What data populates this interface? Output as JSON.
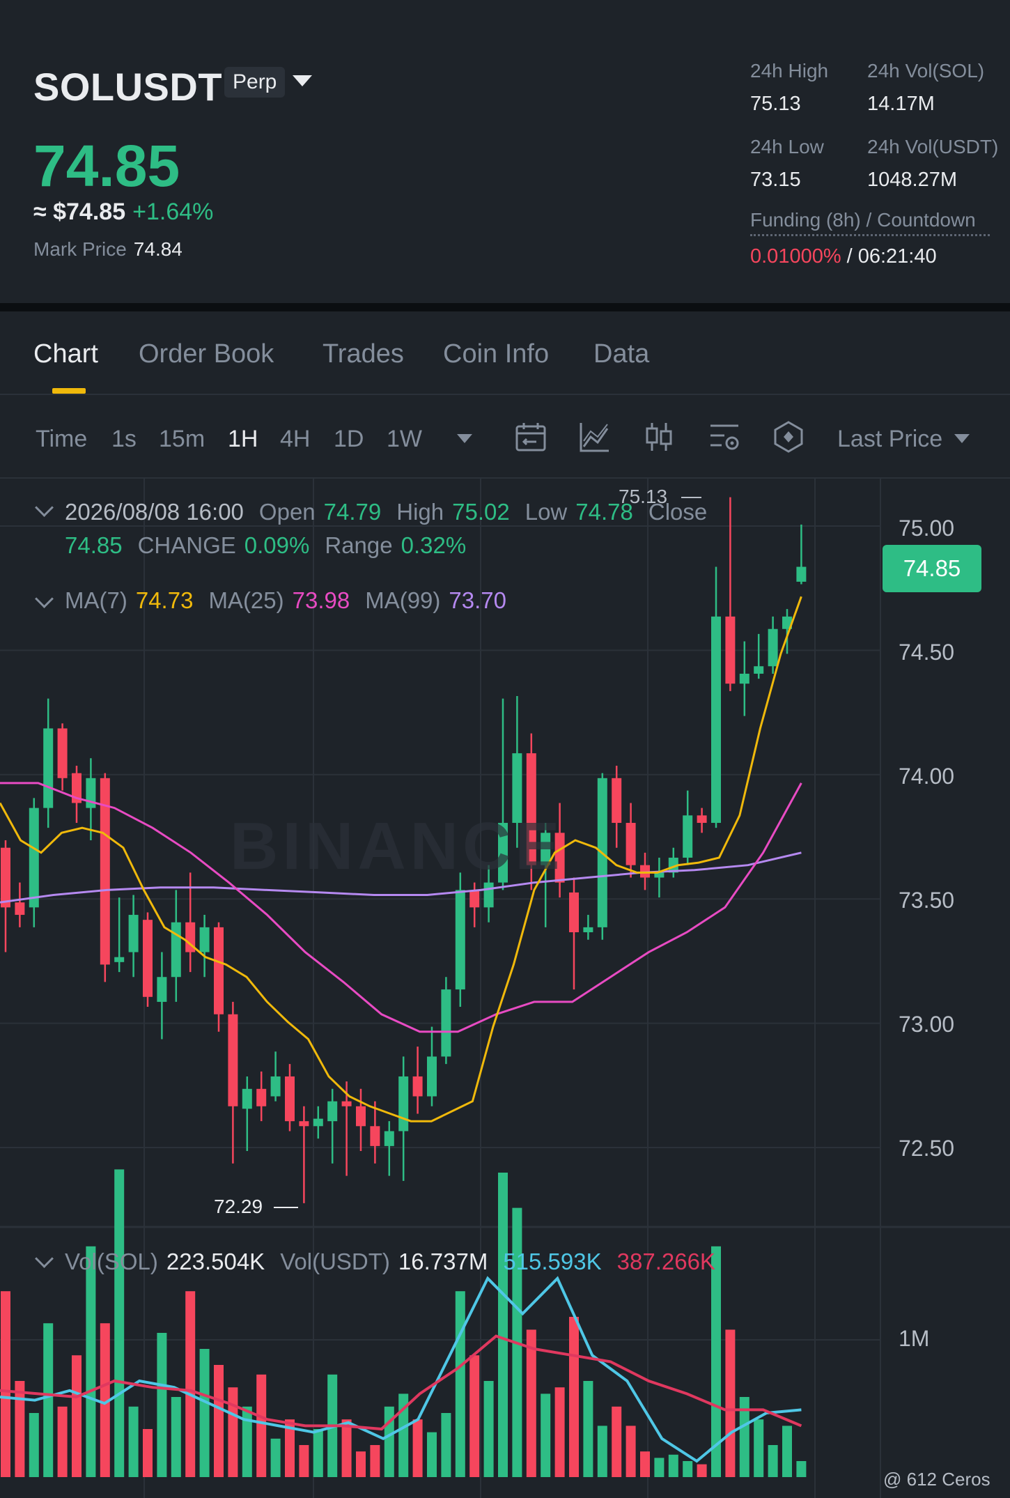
{
  "header": {
    "symbol": "SOLUSDT",
    "badge": "Perp",
    "last_price": "74.85",
    "usd_price": "≈ $74.85",
    "change_pct": "+1.64%",
    "mark_price_label": "Mark Price",
    "mark_price": "74.84",
    "stats": [
      {
        "label": "24h High",
        "value": "75.13"
      },
      {
        "label": "24h Vol(SOL)",
        "value": "14.17M"
      },
      {
        "label": "24h Low",
        "value": "73.15"
      },
      {
        "label": "24h Vol(USDT)",
        "value": "1048.27M"
      }
    ],
    "funding_label": "Funding (8h) / Countdown",
    "funding_rate": "0.01000%",
    "funding_sep": "/",
    "countdown": "06:21:40"
  },
  "tabs": [
    {
      "label": "Chart",
      "active": true
    },
    {
      "label": "Order Book"
    },
    {
      "label": "Trades"
    },
    {
      "label": "Coin Info"
    },
    {
      "label": "Data"
    }
  ],
  "toolbar": {
    "time_label": "Time",
    "intervals": [
      "1s",
      "15m",
      "1H",
      "4H",
      "1D",
      "1W"
    ],
    "active_interval": "1H",
    "price_type": "Last Price",
    "icons": [
      "calendar-icon",
      "indicator-icon",
      "candle-type-icon",
      "settings-icon",
      "drawing-icon"
    ]
  },
  "legend": {
    "date": "2026/08/08 16:00",
    "open_label": "Open",
    "open": "74.79",
    "high_label": "High",
    "high": "75.02",
    "low_label": "Low",
    "low": "74.78",
    "close_label": "Close",
    "close": "74.85",
    "change_label": "CHANGE",
    "change": "0.09%",
    "range_label": "Range",
    "range": "0.32%",
    "ma7_label": "MA(7)",
    "ma7": "74.73",
    "ma25_label": "MA(25)",
    "ma25": "73.98",
    "ma99_label": "MA(99)",
    "ma99": "73.70"
  },
  "volume_legend": {
    "sol_label": "Vol(SOL)",
    "sol": "223.504K",
    "usdt_label": "Vol(USDT)",
    "usdt": "16.737M",
    "ma_a": "515.593K",
    "ma_b": "387.266K"
  },
  "current_price_tag": "74.85",
  "high_marker": "75.13",
  "low_marker": "72.29",
  "watermark": "BINANCE",
  "footer": "@ 612 Ceros",
  "colors": {
    "up": "#2ebd85",
    "down": "#f6465d",
    "ma7": "#f0b90b",
    "ma25": "#e84bc3",
    "ma99": "#b589f0",
    "vol_ma_a": "#4fc7e6",
    "vol_ma_b": "#e0385f"
  },
  "chart_data": {
    "type": "candlestick",
    "y_ticks": [
      "75.00",
      "74.50",
      "74.00",
      "73.50",
      "73.00",
      "72.50"
    ],
    "ylim": [
      72.2,
      75.15
    ],
    "candles": [
      [
        73.72,
        73.48,
        73.75,
        73.3
      ],
      [
        73.5,
        73.45,
        73.58,
        73.4
      ],
      [
        73.48,
        73.88,
        73.92,
        73.4
      ],
      [
        73.88,
        74.2,
        74.32,
        73.8
      ],
      [
        74.2,
        74.0,
        74.22,
        73.95
      ],
      [
        74.02,
        73.9,
        74.05,
        73.82
      ],
      [
        73.88,
        74.0,
        74.08,
        73.75
      ],
      [
        74.0,
        73.25,
        74.02,
        73.18
      ],
      [
        73.26,
        73.28,
        73.52,
        73.22
      ],
      [
        73.3,
        73.45,
        73.53,
        73.2
      ],
      [
        73.43,
        73.12,
        73.46,
        73.08
      ],
      [
        73.1,
        73.2,
        73.3,
        72.95
      ],
      [
        73.2,
        73.42,
        73.55,
        73.1
      ],
      [
        73.42,
        73.3,
        73.62,
        73.22
      ],
      [
        73.3,
        73.4,
        73.45,
        73.2
      ],
      [
        73.4,
        73.05,
        73.42,
        72.98
      ],
      [
        73.05,
        72.68,
        73.1,
        72.45
      ],
      [
        72.67,
        72.75,
        72.8,
        72.5
      ],
      [
        72.75,
        72.68,
        72.82,
        72.62
      ],
      [
        72.72,
        72.8,
        72.9,
        72.7
      ],
      [
        72.8,
        72.62,
        72.85,
        72.58
      ],
      [
        72.62,
        72.6,
        72.68,
        72.29
      ],
      [
        72.6,
        72.63,
        72.68,
        72.55
      ],
      [
        72.62,
        72.7,
        72.75,
        72.45
      ],
      [
        72.7,
        72.68,
        72.78,
        72.4
      ],
      [
        72.68,
        72.6,
        72.75,
        72.5
      ],
      [
        72.6,
        72.52,
        72.7,
        72.45
      ],
      [
        72.52,
        72.58,
        72.62,
        72.4
      ],
      [
        72.58,
        72.8,
        72.88,
        72.38
      ],
      [
        72.8,
        72.72,
        72.92,
        72.65
      ],
      [
        72.72,
        72.88,
        73.0,
        72.68
      ],
      [
        72.88,
        73.15,
        73.2,
        72.85
      ],
      [
        73.15,
        73.55,
        73.62,
        73.08
      ],
      [
        73.55,
        73.48,
        73.58,
        73.4
      ],
      [
        73.48,
        73.58,
        73.65,
        73.42
      ],
      [
        73.58,
        73.82,
        74.32,
        73.55
      ],
      [
        73.82,
        74.1,
        74.33,
        73.72
      ],
      [
        74.1,
        73.65,
        74.18,
        73.55
      ],
      [
        73.65,
        73.78,
        73.82,
        73.4
      ],
      [
        73.78,
        73.58,
        73.9,
        73.52
      ],
      [
        73.54,
        73.38,
        73.6,
        73.15
      ],
      [
        73.38,
        73.4,
        73.45,
        73.35
      ],
      [
        73.4,
        74.0,
        74.02,
        73.35
      ],
      [
        74.0,
        73.82,
        74.05,
        73.72
      ],
      [
        73.82,
        73.65,
        73.9,
        73.6
      ],
      [
        73.65,
        73.6,
        73.7,
        73.55
      ],
      [
        73.6,
        73.62,
        73.68,
        73.52
      ],
      [
        73.62,
        73.68,
        73.72,
        73.6
      ],
      [
        73.68,
        73.85,
        73.95,
        73.65
      ],
      [
        73.85,
        73.82,
        73.88,
        73.78
      ],
      [
        73.82,
        74.65,
        74.85,
        73.8
      ],
      [
        74.65,
        74.38,
        75.13,
        74.35
      ],
      [
        74.38,
        74.42,
        74.55,
        74.25
      ],
      [
        74.42,
        74.45,
        74.58,
        74.4
      ],
      [
        74.45,
        74.6,
        74.65,
        74.42
      ],
      [
        74.6,
        74.65,
        74.68,
        74.5
      ],
      [
        74.79,
        74.85,
        75.02,
        74.78
      ]
    ],
    "ma7": [
      73.9,
      73.75,
      73.7,
      73.78,
      73.8,
      73.78,
      73.72,
      73.55,
      73.4,
      73.35,
      73.28,
      73.25,
      73.2,
      73.1,
      73.02,
      72.95,
      72.8,
      72.72,
      72.68,
      72.65,
      72.62,
      72.62,
      72.66,
      72.7,
      73.0,
      73.25,
      73.55,
      73.7,
      73.75,
      73.72,
      73.65,
      73.62,
      73.62,
      73.65,
      73.66,
      73.68,
      73.85,
      74.2,
      74.5,
      74.73
    ],
    "ma25": [
      73.98,
      73.98,
      73.92,
      73.88,
      73.8,
      73.7,
      73.58,
      73.45,
      73.3,
      73.18,
      73.05,
      72.98,
      72.98,
      73.05,
      73.1,
      73.1,
      73.2,
      73.3,
      73.38,
      73.48,
      73.7,
      73.98
    ],
    "ma99": [
      73.5,
      73.53,
      73.55,
      73.56,
      73.56,
      73.55,
      73.54,
      73.53,
      73.53,
      73.55,
      73.58,
      73.6,
      73.62,
      73.63,
      73.65,
      73.7
    ]
  },
  "volume_chart": {
    "y_tick": "1M",
    "bars": [
      0.58,
      0.3,
      0.2,
      0.48,
      0.22,
      0.38,
      0.72,
      0.48,
      0.96,
      0.22,
      0.15,
      0.45,
      0.25,
      0.58,
      0.4,
      0.35,
      0.28,
      0.22,
      0.32,
      0.12,
      0.18,
      0.1,
      0.15,
      0.32,
      0.18,
      0.08,
      0.1,
      0.22,
      0.26,
      0.18,
      0.14,
      0.2,
      0.58,
      0.38,
      0.3,
      0.95,
      0.84,
      0.46,
      0.26,
      0.28,
      0.5,
      0.3,
      0.16,
      0.22,
      0.16,
      0.08,
      0.06,
      0.07,
      0.05,
      0.04,
      0.72,
      0.46,
      0.25,
      0.18,
      0.1,
      0.16,
      0.05
    ],
    "ma_a": [
      0.25,
      0.24,
      0.27,
      0.23,
      0.3,
      0.28,
      0.23,
      0.18,
      0.16,
      0.14,
      0.17,
      0.12,
      0.18,
      0.4,
      0.62,
      0.51,
      0.62,
      0.38,
      0.3,
      0.12,
      0.05,
      0.14,
      0.2,
      0.21
    ],
    "ma_b": [
      0.27,
      0.26,
      0.25,
      0.3,
      0.28,
      0.27,
      0.23,
      0.18,
      0.16,
      0.16,
      0.15,
      0.26,
      0.34,
      0.44,
      0.4,
      0.38,
      0.36,
      0.3,
      0.26,
      0.21,
      0.21,
      0.16
    ]
  }
}
